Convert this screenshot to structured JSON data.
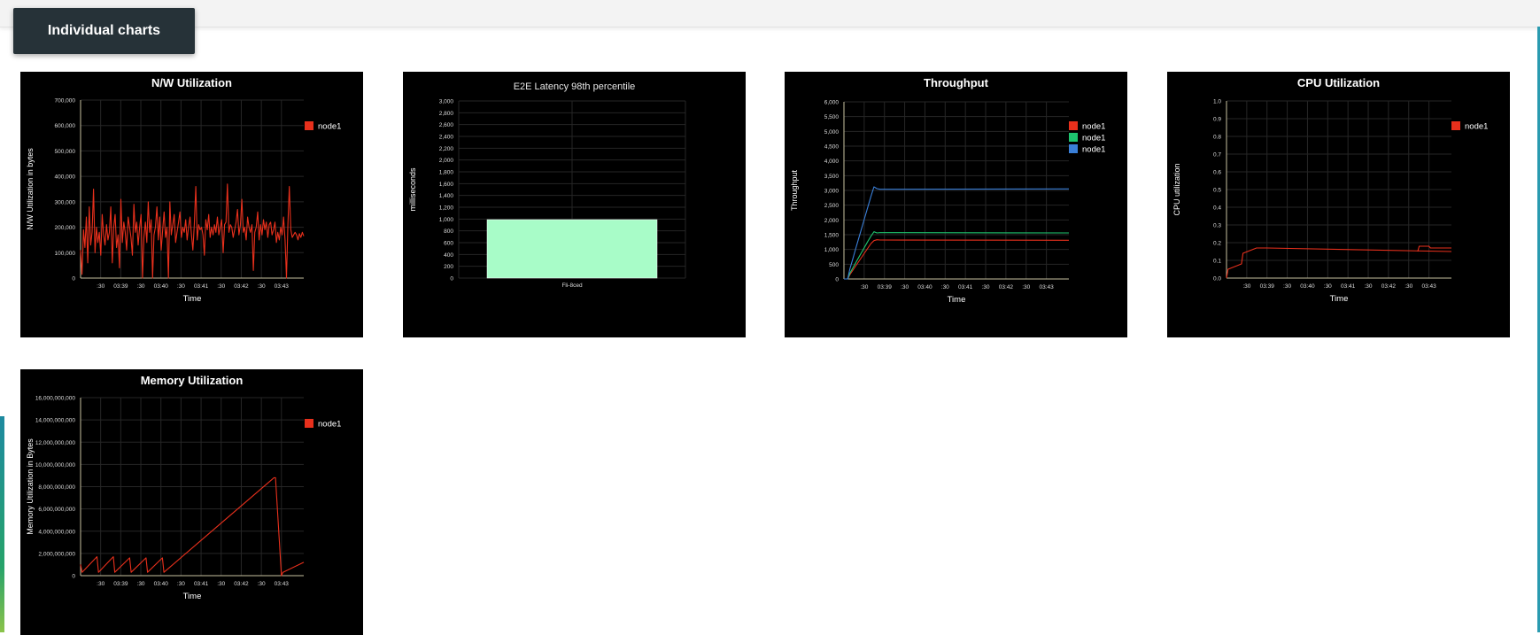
{
  "section_tab": {
    "label": "Individual charts"
  },
  "chart_data": [
    {
      "id": "nw",
      "type": "line",
      "title": "N/W Utilization",
      "xlabel": "Time",
      "ylabel": "N/W Utilization in bytes",
      "ylim": [
        0,
        700000
      ],
      "yticks": [
        0,
        100000,
        200000,
        300000,
        400000,
        500000,
        600000,
        700000
      ],
      "ytick_labels": [
        "0",
        "100,000",
        "200,000",
        "300,000",
        "400,000",
        "500,000",
        "600,000",
        "700,000"
      ],
      "xlim": [
        0,
        300
      ],
      "xtick_values": [
        27,
        54,
        81,
        108,
        135,
        162,
        189,
        216,
        243,
        270
      ],
      "xtick_labels": [
        ":30",
        "03:39",
        ":30",
        "03:40",
        ":30",
        "03:41",
        ":30",
        "03:42",
        ":30",
        "03:43"
      ],
      "legend": "top-right",
      "grid": true,
      "series": [
        {
          "name": "node1",
          "color": "#e8301c",
          "values": [
            110000,
            15000,
            190000,
            120000,
            240000,
            60000,
            280000,
            130000,
            180000,
            350000,
            100000,
            200000,
            140000,
            180000,
            90000,
            250000,
            170000,
            130000,
            210000,
            150000,
            180000,
            280000,
            60000,
            200000,
            250000,
            120000,
            170000,
            40000,
            310000,
            140000,
            220000,
            180000,
            110000,
            240000,
            200000,
            160000,
            90000,
            290000,
            180000,
            220000,
            130000,
            200000,
            250000,
            0,
            160000,
            220000,
            140000,
            300000,
            180000,
            230000,
            0,
            170000,
            200000,
            280000,
            150000,
            240000,
            110000,
            190000,
            260000,
            160000,
            200000,
            0,
            300000,
            170000,
            210000,
            250000,
            140000,
            180000,
            220000,
            260000,
            160000,
            200000,
            180000,
            230000,
            150000,
            200000,
            240000,
            170000,
            110000,
            210000,
            360000,
            150000,
            210000,
            190000,
            200000,
            170000,
            90000,
            230000,
            190000,
            250000,
            160000,
            200000,
            170000,
            210000,
            180000,
            240000,
            170000,
            200000,
            230000,
            100000,
            210000,
            220000,
            370000,
            180000,
            210000,
            200000,
            160000,
            190000,
            220000,
            270000,
            170000,
            210000,
            310000,
            180000,
            200000,
            150000,
            240000,
            200000,
            180000,
            210000,
            30000,
            180000,
            200000,
            260000,
            150000,
            210000,
            170000,
            230000,
            190000,
            220000,
            160000,
            210000,
            220000,
            170000,
            190000,
            220000,
            140000,
            180000,
            150000,
            200000,
            170000,
            240000,
            150000,
            0,
            210000,
            360000,
            190000,
            160000,
            170000,
            180000,
            170000,
            150000,
            175000,
            160000,
            180000,
            165000
          ]
        }
      ]
    },
    {
      "id": "latency",
      "type": "bar",
      "title": "E2E Latency 98th percentile",
      "xlabel": "",
      "ylabel": "milliseconds",
      "ylim": [
        0,
        3000
      ],
      "yticks": [
        0,
        200,
        400,
        600,
        800,
        1000,
        1200,
        1400,
        1600,
        1800,
        2000,
        2200,
        2400,
        2600,
        2800,
        3000
      ],
      "ytick_labels": [
        "0",
        "200",
        "400",
        "600",
        "800",
        "1,000",
        "1,200",
        "1,400",
        "1,600",
        "1,800",
        "2,000",
        "2,200",
        "2,400",
        "2,600",
        "2,800",
        "3,000"
      ],
      "categories": [
        "Fli-8ced"
      ],
      "values": [
        990
      ],
      "color": "#a8fcc8",
      "grid": true
    },
    {
      "id": "throughput",
      "type": "line",
      "title": "Throughput",
      "xlabel": "Time",
      "ylabel": "Throughput",
      "ylim": [
        0,
        6000
      ],
      "yticks": [
        0,
        500,
        1000,
        1500,
        2000,
        2500,
        3000,
        3500,
        4000,
        4500,
        5000,
        5500,
        6000
      ],
      "ytick_labels": [
        "0",
        "500",
        "1,000",
        "1,500",
        "2,000",
        "2,500",
        "3,000",
        "3,500",
        "4,000",
        "4,500",
        "5,000",
        "5,500",
        "6,000"
      ],
      "xlim": [
        0,
        300
      ],
      "xtick_values": [
        27,
        54,
        81,
        108,
        135,
        162,
        189,
        216,
        243,
        270
      ],
      "xtick_labels": [
        ":30",
        "03:39",
        ":30",
        "03:40",
        ":30",
        "03:41",
        ":30",
        "03:42",
        ":30",
        "03:43"
      ],
      "legend": "top-right",
      "grid": true,
      "series": [
        {
          "name": "node1",
          "color": "#e8301c",
          "x": [
            0,
            5,
            8,
            12,
            16,
            20,
            24,
            28,
            32,
            36,
            40,
            44,
            48,
            300
          ],
          "values": [
            0,
            0,
            150,
            300,
            450,
            600,
            750,
            900,
            1050,
            1200,
            1300,
            1330,
            1320,
            1310
          ]
        },
        {
          "name": "node1",
          "color": "#1ec46e",
          "x": [
            0,
            5,
            8,
            12,
            16,
            20,
            24,
            28,
            32,
            36,
            40,
            44,
            48,
            300
          ],
          "values": [
            0,
            0,
            200,
            380,
            560,
            740,
            920,
            1100,
            1280,
            1450,
            1600,
            1560,
            1570,
            1560
          ]
        },
        {
          "name": "node1",
          "color": "#3a7fd8",
          "x": [
            0,
            5,
            8,
            12,
            16,
            20,
            24,
            28,
            32,
            36,
            40,
            44,
            48,
            300
          ],
          "values": [
            0,
            0,
            350,
            700,
            1050,
            1400,
            1750,
            2100,
            2450,
            2800,
            3120,
            3060,
            3040,
            3050
          ]
        }
      ]
    },
    {
      "id": "cpu",
      "type": "line",
      "title": "CPU Utilization",
      "xlabel": "Time",
      "ylabel": "CPU utilization",
      "ylim": [
        0,
        1
      ],
      "yticks": [
        0,
        0.1,
        0.2,
        0.3,
        0.4,
        0.5,
        0.6,
        0.7,
        0.8,
        0.9,
        1
      ],
      "ytick_labels": [
        "0.0",
        "0.1",
        "0.2",
        "0.3",
        "0.4",
        "0.5",
        "0.6",
        "0.7",
        "0.8",
        "0.9",
        "1.0"
      ],
      "xlim": [
        0,
        300
      ],
      "xtick_values": [
        27,
        54,
        81,
        108,
        135,
        162,
        189,
        216,
        243,
        270
      ],
      "xtick_labels": [
        ":30",
        "03:39",
        ":30",
        "03:40",
        ":30",
        "03:41",
        ":30",
        "03:42",
        ":30",
        "03:43"
      ],
      "legend": "top-right",
      "grid": true,
      "series": [
        {
          "name": "node1",
          "color": "#e8301c",
          "x": [
            0,
            2,
            20,
            22,
            40,
            54,
            300
          ],
          "values": [
            0,
            0.05,
            0.08,
            0.14,
            0.17,
            0.17,
            0.15
          ]
        },
        {
          "name": "node1",
          "color": "#e8301c",
          "x": [
            255,
            257,
            270,
            272,
            300
          ],
          "values": [
            0.15,
            0.18,
            0.18,
            0.17,
            0.17
          ]
        }
      ]
    },
    {
      "id": "memory",
      "type": "line",
      "title": "Memory Utilization",
      "xlabel": "Time",
      "ylabel": "Memory Utilization in Bytes",
      "ylim": [
        0,
        16000000000
      ],
      "yticks": [
        0,
        2000000000,
        4000000000,
        6000000000,
        8000000000,
        10000000000,
        12000000000,
        14000000000,
        16000000000
      ],
      "ytick_labels": [
        "0",
        "2,000,000,000",
        "4,000,000,000",
        "6,000,000,000",
        "8,000,000,000",
        "10,000,000,000",
        "12,000,000,000",
        "14,000,000,000",
        "16,000,000,000"
      ],
      "xlim": [
        0,
        300
      ],
      "xtick_values": [
        27,
        54,
        81,
        108,
        135,
        162,
        189,
        216,
        243,
        270
      ],
      "xtick_labels": [
        ":30",
        "03:39",
        ":30",
        "03:40",
        ":30",
        "03:41",
        ":30",
        "03:42",
        ":30",
        "03:43"
      ],
      "legend": "top-right",
      "grid": true,
      "series": [
        {
          "name": "node1",
          "color": "#e8301c",
          "x": [
            0,
            2,
            22,
            24,
            44,
            46,
            66,
            68,
            88,
            90,
            110,
            112,
            260,
            262,
            270,
            272,
            300
          ],
          "values": [
            1000000000,
            300000000,
            1700000000,
            300000000,
            1700000000,
            300000000,
            1600000000,
            300000000,
            1600000000,
            300000000,
            1600000000,
            300000000,
            8800000000,
            8800000000,
            0,
            300000000,
            1200000000
          ]
        }
      ]
    }
  ]
}
